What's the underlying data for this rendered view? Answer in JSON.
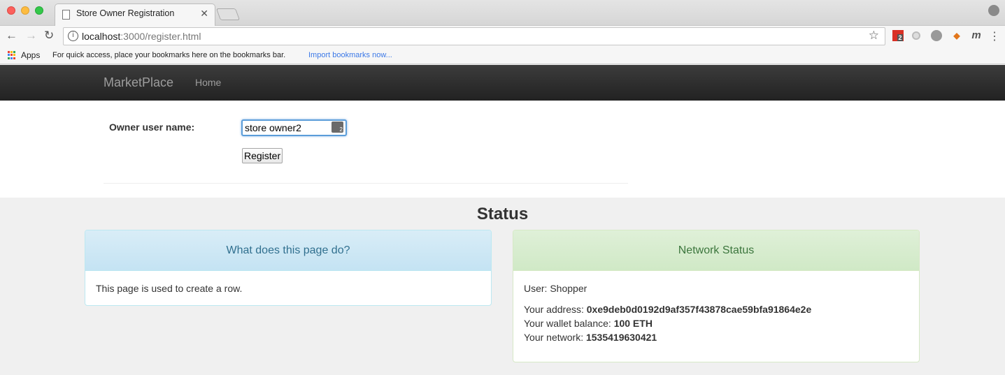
{
  "browser": {
    "tab_title": "Store Owner Registration",
    "tab_close": "✕",
    "url_host": "localhost",
    "url_rest": ":3000/register.html",
    "extension_badge": "2",
    "extension_m": "m",
    "bookmarks": {
      "apps_label": "Apps",
      "hint": "For quick access, place your bookmarks here on the bookmarks bar.",
      "import_link": "Import bookmarks now..."
    }
  },
  "navbar": {
    "brand": "MarketPlace",
    "home": "Home"
  },
  "form": {
    "owner_label": "Owner user name:",
    "owner_value": "store owner2",
    "password_manager_badge": "2",
    "register_label": "Register"
  },
  "status": {
    "title": "Status",
    "info_panel": {
      "heading": "What does this page do?",
      "body": "This page is used to create a row."
    },
    "network_panel": {
      "heading": "Network Status",
      "user_label": "User: Shopper",
      "address_label": "Your address: ",
      "address_value": "0xe9deb0d0192d9af357f43878cae59bfa91864e2e",
      "balance_label": "Your wallet balance: ",
      "balance_value": "100 ETH",
      "network_label": "Your network: ",
      "network_value": "1535419630421"
    }
  }
}
